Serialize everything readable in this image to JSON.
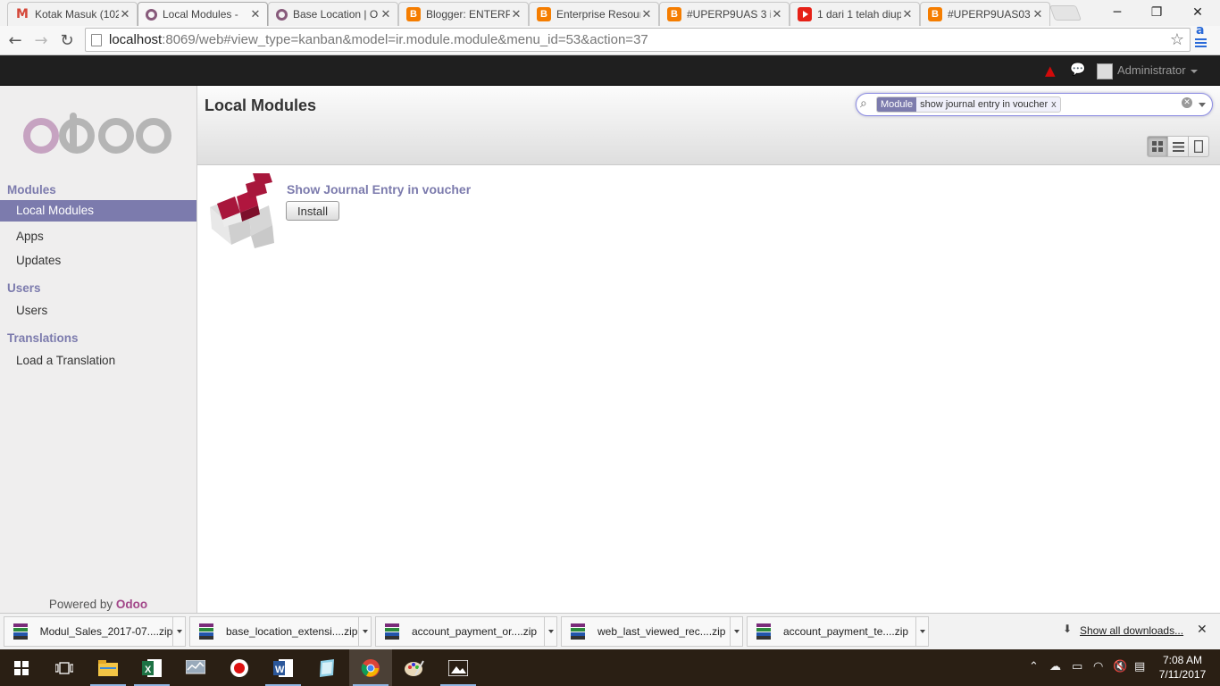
{
  "browser": {
    "tabs": [
      {
        "label": "Kotak Masuk (102",
        "favicon": "gmail-icon",
        "active": false
      },
      {
        "label": "Local Modules - ",
        "favicon": "odoo-icon",
        "active": true
      },
      {
        "label": "Base Location | O",
        "favicon": "odoo-icon",
        "active": false
      },
      {
        "label": "Blogger: ENTERPI",
        "favicon": "blogger-icon",
        "active": false
      },
      {
        "label": "Enterprise Resour",
        "favicon": "blogger-icon",
        "active": false
      },
      {
        "label": "#UPERP9UAS 3 in",
        "favicon": "blogger-icon",
        "active": false
      },
      {
        "label": "1 dari 1 telah diup",
        "favicon": "youtube-icon",
        "active": false
      },
      {
        "label": "#UPERP9UAS03 - ",
        "favicon": "blogger-icon",
        "active": false
      }
    ],
    "url_host": "localhost",
    "url_rest": ":8069/web#view_type=kanban&model=ir.module.module&menu_id=53&action=37",
    "extension_letter": "a"
  },
  "topbar": {
    "user_name": "Administrator"
  },
  "sidebar": {
    "logo_text": "odoo",
    "sections": [
      {
        "header": "Modules",
        "items": [
          "Local Modules",
          "Apps",
          "Updates"
        ]
      },
      {
        "header": "Users",
        "items": [
          "Users"
        ]
      },
      {
        "header": "Translations",
        "items": [
          "Load a Translation"
        ]
      }
    ],
    "active_item": "Local Modules",
    "powered_prefix": "Powered by ",
    "powered_brand": "Odoo"
  },
  "main": {
    "title": "Local Modules",
    "search": {
      "facet_category": "Module",
      "facet_value": "show journal entry in voucher",
      "facet_remove": "x"
    },
    "views": [
      "kanban",
      "list",
      "form"
    ],
    "active_view": "kanban",
    "modules": [
      {
        "name": "Show Journal Entry in voucher",
        "button": "Install"
      }
    ]
  },
  "downloads": {
    "items": [
      "Modul_Sales_2017-07....zip",
      "base_location_extensi....zip",
      "account_payment_or....zip",
      "web_last_viewed_rec....zip",
      "account_payment_te....zip"
    ],
    "show_all": "Show all downloads..."
  },
  "taskbar": {
    "time": "7:08 AM",
    "date": "7/11/2017"
  },
  "colors": {
    "odoo_purple": "#7c7bad",
    "odoo_brand": "#a24689",
    "module_red": "#a8173c"
  }
}
